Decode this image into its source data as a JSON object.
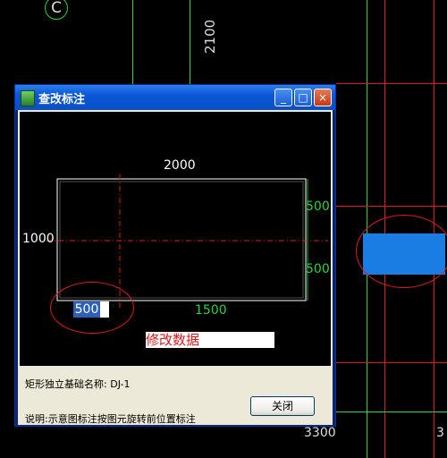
{
  "cad": {
    "axis_label": "C",
    "dim_top": "2100",
    "dim_bottom_left": "3300",
    "dim_bottom_right": "3"
  },
  "dialog": {
    "title": "查改标注",
    "buttons": {
      "minimize": "_",
      "maximize": "□",
      "close": "×"
    },
    "preview": {
      "dim_width": "2000",
      "dim_height": "1000",
      "dim_right_top": "500",
      "dim_right_bottom": "500",
      "dim_bottom_left": "500",
      "dim_bottom_right": "1500",
      "edit_hint": "修改数据"
    },
    "foundation_name_label": "矩形独立基础名称:",
    "foundation_name_value": "DJ-1",
    "note": "说明:示意图标注按图元旋转前位置标注",
    "close_button": "关闭"
  },
  "colors": {
    "cad_green": "#2bd43b",
    "cad_red": "#e01818",
    "highlight_blue": "#1a7de3",
    "title_blue": "#0a57d6"
  }
}
